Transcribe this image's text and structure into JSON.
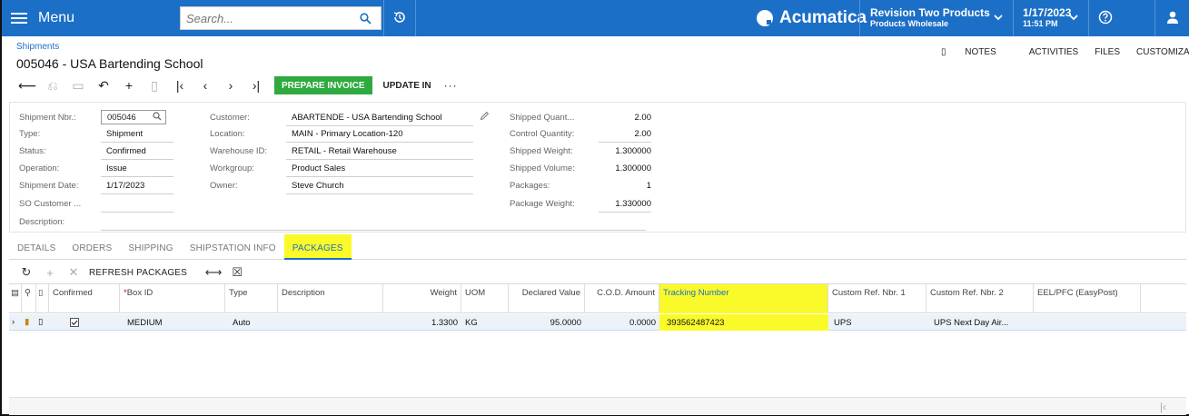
{
  "topbar": {
    "menu_label": "Menu",
    "search_placeholder": "Search...",
    "logo_text": "Acumatica",
    "tenant_name": "Revision Two Products",
    "tenant_branch": "Products Wholesale",
    "date": "1/17/2023",
    "time": "11:51 PM",
    "accent": "#1c6fc6"
  },
  "header": {
    "breadcrumb": "Shipments",
    "title": "005046 - USA Bartending School",
    "links": {
      "notes": "NOTES",
      "activities": "ACTIVITIES",
      "files": "FILES",
      "customization": "CUSTOMIZATI"
    }
  },
  "toolbar": {
    "prepare_invoice": "PREPARE INVOICE",
    "update_in": "UPDATE IN",
    "more": "···"
  },
  "form": {
    "shipment_nbr_label": "Shipment Nbr.:",
    "shipment_nbr": "005046",
    "type_label": "Type:",
    "type": "Shipment",
    "status_label": "Status:",
    "status": "Confirmed",
    "operation_label": "Operation:",
    "operation": "Issue",
    "shipment_date_label": "Shipment Date:",
    "shipment_date": "1/17/2023",
    "so_customer_label": "SO Customer ...",
    "description_label": "Description:",
    "customer_label": "Customer:",
    "customer": "ABARTENDE - USA Bartending School",
    "location_label": "Location:",
    "location": "MAIN - Primary Location-120",
    "warehouse_label": "Warehouse ID:",
    "warehouse": "RETAIL - Retail Warehouse",
    "workgroup_label": "Workgroup:",
    "workgroup": "Product Sales",
    "owner_label": "Owner:",
    "owner": "Steve Church",
    "shipped_qty_label": "Shipped Quant...",
    "shipped_qty": "2.00",
    "control_qty_label": "Control Quantity:",
    "control_qty": "2.00",
    "shipped_weight_label": "Shipped Weight:",
    "shipped_weight": "1.300000",
    "shipped_volume_label": "Shipped Volume:",
    "shipped_volume": "1.300000",
    "packages_label": "Packages:",
    "packages": "1",
    "package_weight_label": "Package Weight:",
    "package_weight": "1.330000"
  },
  "tabs": [
    "DETAILS",
    "ORDERS",
    "SHIPPING",
    "SHIPSTATION INFO",
    "PACKAGES"
  ],
  "grid_toolbar": {
    "refresh": "REFRESH PACKAGES"
  },
  "grid": {
    "headers": {
      "confirmed": "Confirmed",
      "box_id": "Box ID",
      "type": "Type",
      "description": "Description",
      "weight": "Weight",
      "uom": "UOM",
      "declared_value": "Declared Value",
      "cod_amount": "C.O.D. Amount",
      "tracking": "Tracking Number",
      "custom_ref1": "Custom Ref. Nbr. 1",
      "custom_ref2": "Custom Ref. Nbr. 2",
      "eel_pfc": "EEL/PFC (EasyPost)"
    },
    "row": {
      "box_id": "MEDIUM",
      "type": "Auto",
      "weight": "1.3300",
      "uom": "KG",
      "declared_value": "95.0000",
      "cod_amount": "0.0000",
      "tracking": "393562487423",
      "custom_ref1": "UPS",
      "custom_ref2": "UPS Next Day Air..."
    }
  }
}
